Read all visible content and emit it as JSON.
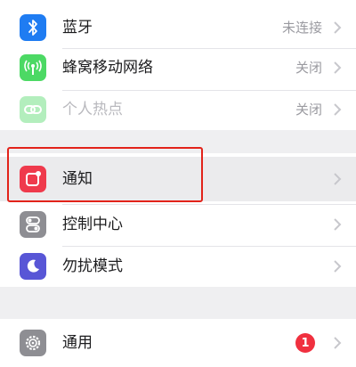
{
  "settings": {
    "bluetooth": {
      "label": "蓝牙",
      "value": "未连接",
      "icon": "bluetooth-icon",
      "color": "#1f7cf2"
    },
    "cellular": {
      "label": "蜂窝移动网络",
      "value": "关闭",
      "icon": "cellular-antenna-icon",
      "color": "#4cd964"
    },
    "hotspot": {
      "label": "个人热点",
      "value": "关闭",
      "icon": "hotspot-link-icon",
      "color": "#4cd964",
      "enabled": false
    },
    "notifications": {
      "label": "通知",
      "icon": "notifications-icon",
      "color": "#ef3a4c",
      "highlighted": true
    },
    "control_center": {
      "label": "控制中心",
      "icon": "control-center-toggles-icon",
      "color": "#8e8e93"
    },
    "do_not_disturb": {
      "label": "勿扰模式",
      "icon": "moon-icon",
      "color": "#5856d6"
    },
    "general": {
      "label": "通用",
      "badge": "1",
      "icon": "gear-icon",
      "color": "#8e8e93"
    }
  },
  "highlight_color": "#e2231a"
}
